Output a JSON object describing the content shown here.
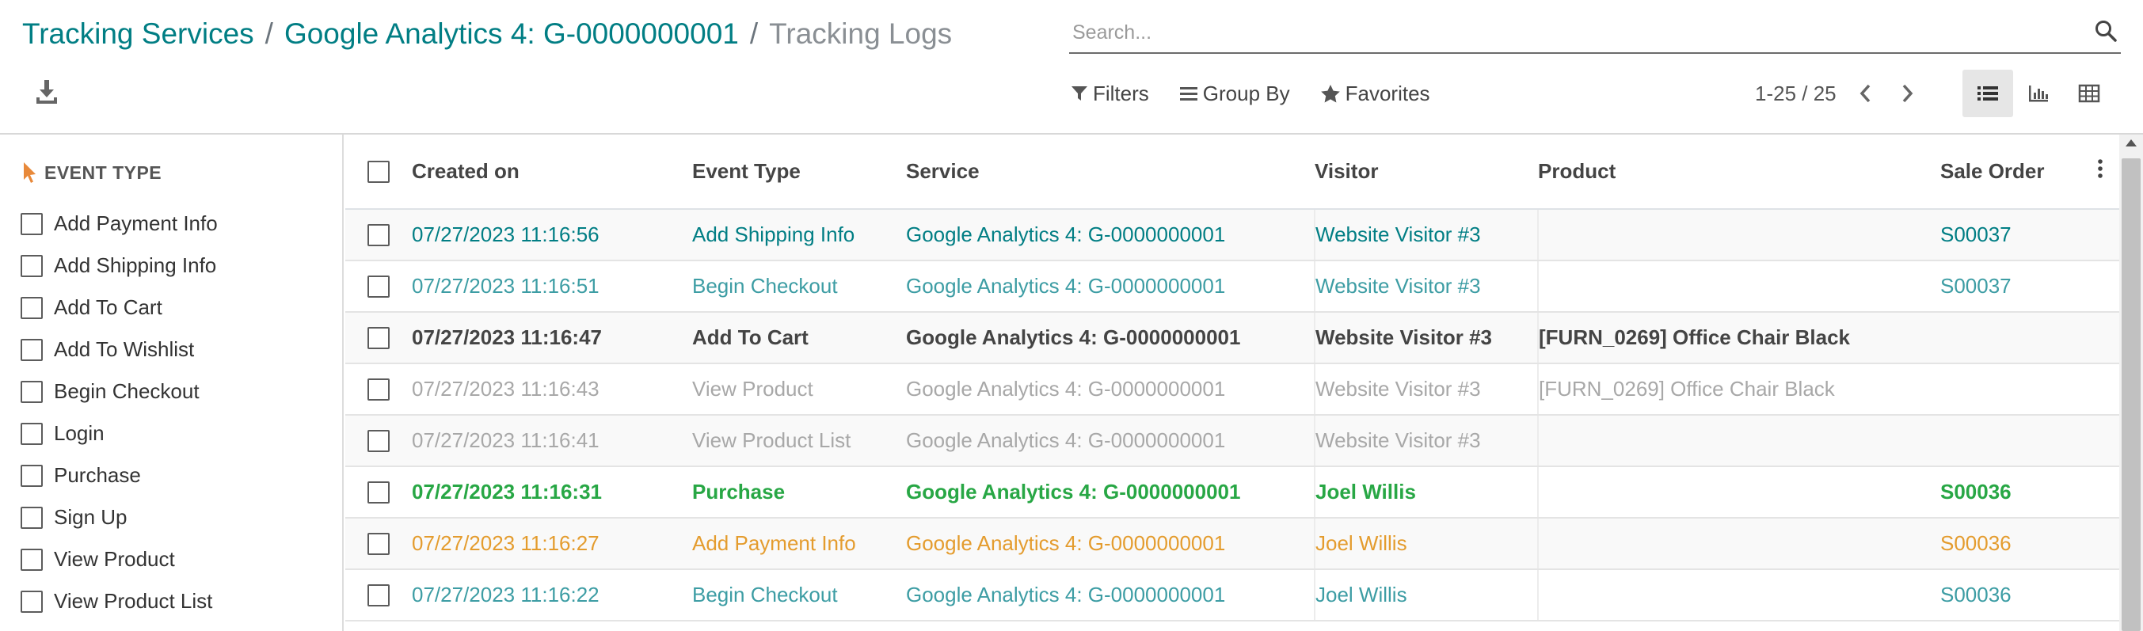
{
  "breadcrumb": {
    "items": [
      "Tracking Services",
      "Google Analytics 4: G-0000000001"
    ],
    "separator": "/",
    "current": "Tracking Logs"
  },
  "search": {
    "placeholder": "Search..."
  },
  "toolbar": {
    "filters_label": "Filters",
    "groupby_label": "Group By",
    "favorites_label": "Favorites"
  },
  "pager": {
    "value": "1-25 / 25"
  },
  "views": [
    "list",
    "graph",
    "pivot"
  ],
  "active_view": "list",
  "search_panel": {
    "title": "EVENT TYPE",
    "items": [
      "Add Payment Info",
      "Add Shipping Info",
      "Add To Cart",
      "Add To Wishlist",
      "Begin Checkout",
      "Login",
      "Purchase",
      "Sign Up",
      "View Product",
      "View Product List"
    ]
  },
  "table": {
    "columns": [
      "Created on",
      "Event Type",
      "Service",
      "Visitor",
      "Product",
      "Sale Order"
    ],
    "rows": [
      {
        "created_on": "07/27/2023 11:16:56",
        "event_type": "Add Shipping Info",
        "service": "Google Analytics 4: G-0000000001",
        "visitor": "Website Visitor #3",
        "product": "",
        "sale_order": "S00037",
        "style": "info"
      },
      {
        "created_on": "07/27/2023 11:16:51",
        "event_type": "Begin Checkout",
        "service": "Google Analytics 4: G-0000000001",
        "visitor": "Website Visitor #3",
        "product": "",
        "sale_order": "S00037",
        "style": "link"
      },
      {
        "created_on": "07/27/2023 11:16:47",
        "event_type": "Add To Cart",
        "service": "Google Analytics 4: G-0000000001",
        "visitor": "Website Visitor #3",
        "product": "[FURN_0269] Office Chair Black",
        "sale_order": "",
        "style": "bold"
      },
      {
        "created_on": "07/27/2023 11:16:43",
        "event_type": "View Product",
        "service": "Google Analytics 4: G-0000000001",
        "visitor": "Website Visitor #3",
        "product": "[FURN_0269] Office Chair Black",
        "sale_order": "",
        "style": "muted"
      },
      {
        "created_on": "07/27/2023 11:16:41",
        "event_type": "View Product List",
        "service": "Google Analytics 4: G-0000000001",
        "visitor": "Website Visitor #3",
        "product": "",
        "sale_order": "",
        "style": "muted"
      },
      {
        "created_on": "07/27/2023 11:16:31",
        "event_type": "Purchase",
        "service": "Google Analytics 4: G-0000000001",
        "visitor": "Joel Willis",
        "product": "",
        "sale_order": "S00036",
        "style": "success"
      },
      {
        "created_on": "07/27/2023 11:16:27",
        "event_type": "Add Payment Info",
        "service": "Google Analytics 4: G-0000000001",
        "visitor": "Joel Willis",
        "product": "",
        "sale_order": "S00036",
        "style": "warning"
      },
      {
        "created_on": "07/27/2023 11:16:22",
        "event_type": "Begin Checkout",
        "service": "Google Analytics 4: G-0000000001",
        "visitor": "Joel Willis",
        "product": "",
        "sale_order": "S00036",
        "style": "link"
      }
    ]
  },
  "colors": {
    "primary": "#017e84",
    "link": "#3d9da4",
    "muted": "#a8a8a8",
    "success": "#28a745",
    "warning": "#e49c2e",
    "accent_icon": "#e8893a"
  }
}
